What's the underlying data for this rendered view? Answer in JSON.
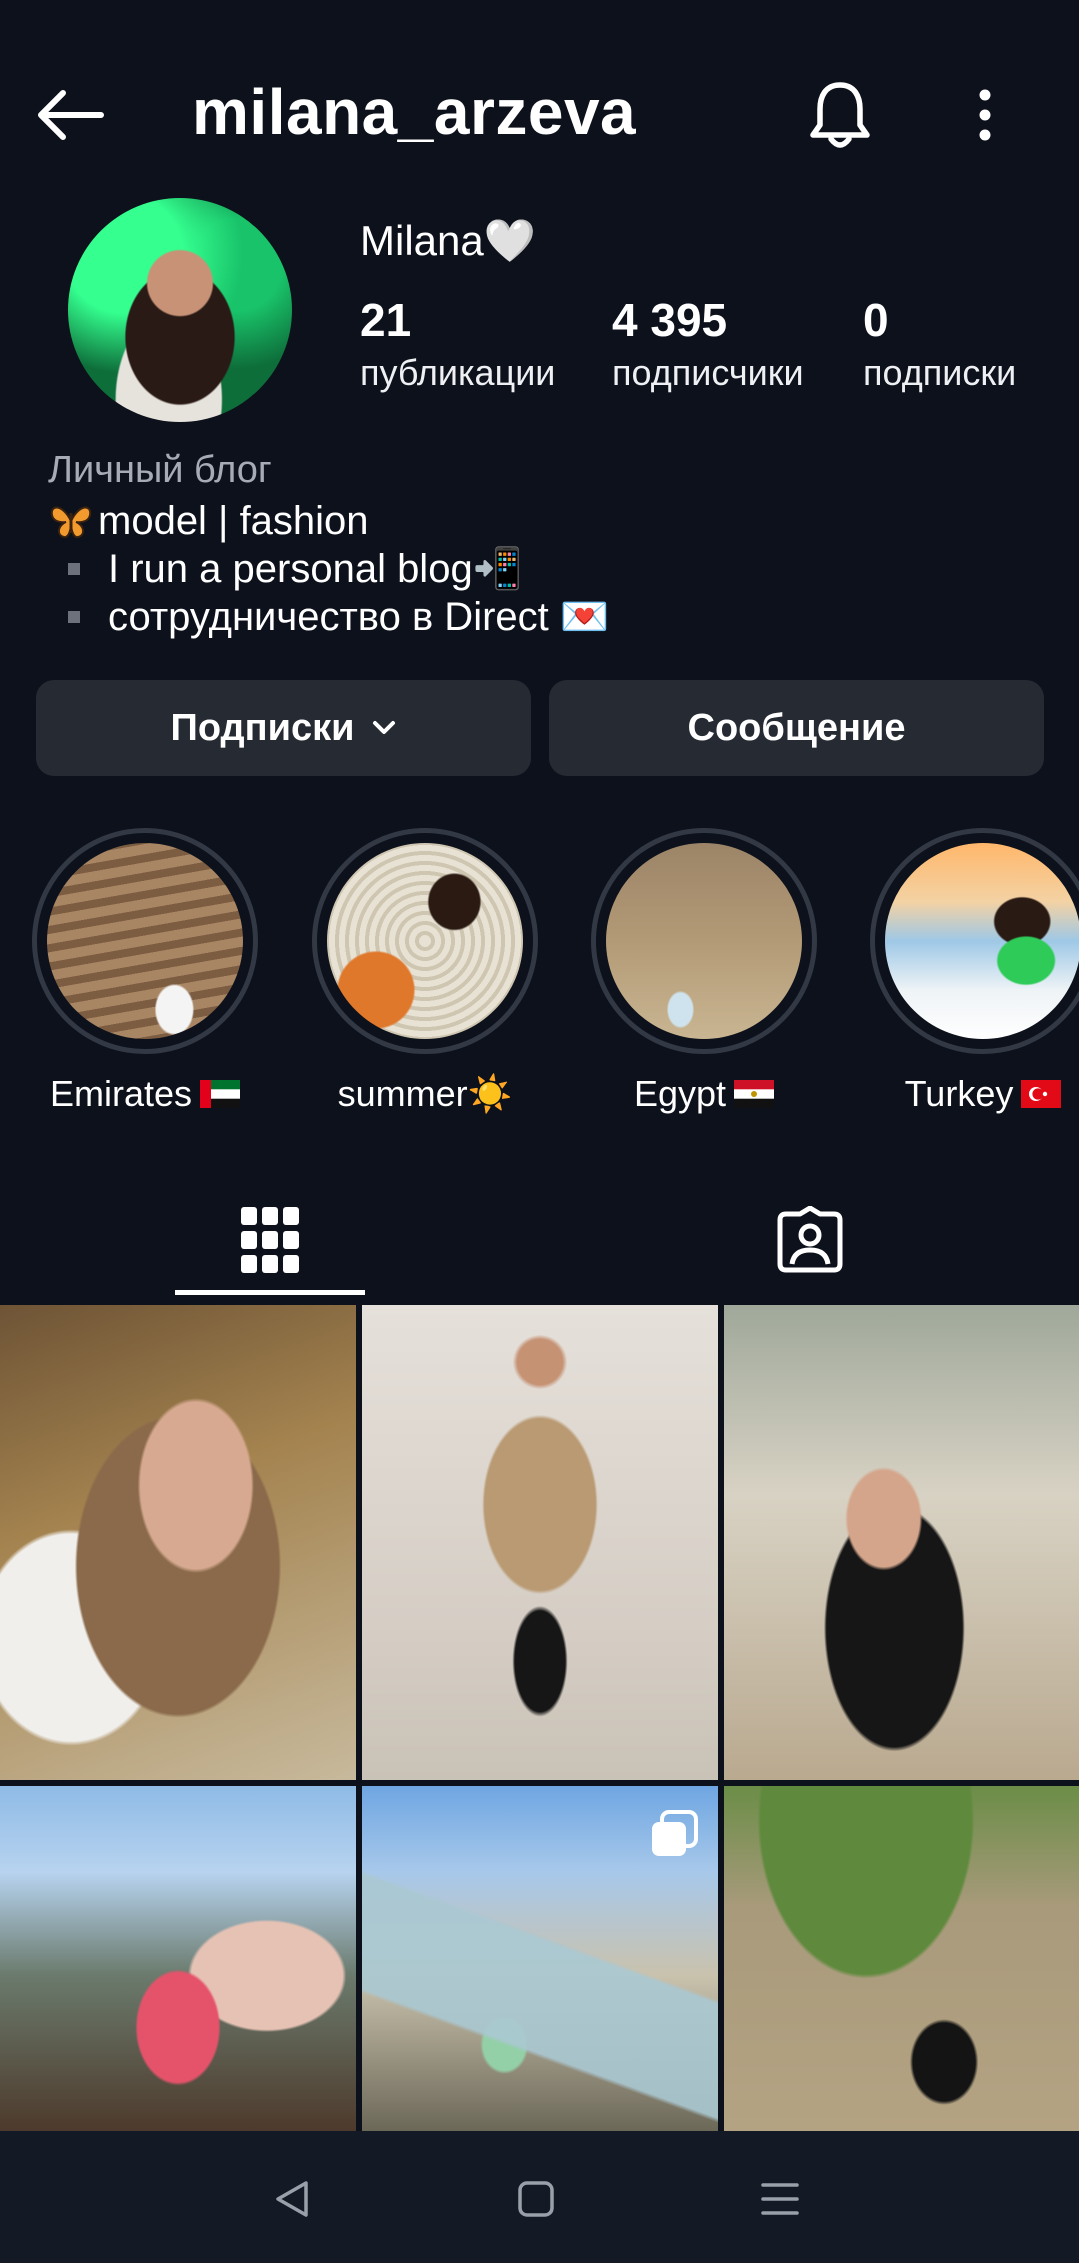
{
  "header": {
    "username": "milana_arzeva",
    "back_icon": "arrow-left-icon",
    "bell_icon": "bell-icon",
    "more_icon": "more-vertical-icon"
  },
  "profile": {
    "display_name": "Milana🤍",
    "stats": [
      {
        "value": "21",
        "label": "публикации"
      },
      {
        "value": "4 395",
        "label": "подписчики"
      },
      {
        "value": "0",
        "label": "подписки"
      }
    ],
    "category": "Личный блог",
    "bio": {
      "line1": "model | fashion",
      "line2": "I run a personal blog📲",
      "line3": "сотрудничество в Direct 💌"
    }
  },
  "buttons": {
    "follow_label": "Подписки",
    "message_label": "Сообщение"
  },
  "highlights": [
    {
      "label": "Emirates",
      "flag": "ae"
    },
    {
      "label": "summer☀️",
      "flag": ""
    },
    {
      "label": "Egypt",
      "flag": "eg"
    },
    {
      "label": "Turkey",
      "flag": "tr"
    }
  ],
  "tabs": {
    "grid_icon": "grid-icon",
    "tagged_icon": "tagged-person-icon",
    "active": "grid"
  },
  "colors": {
    "background": "#0c111b",
    "button_bg": "#262b33",
    "muted_text": "#a6abb5",
    "navbar_bg": "#141a25"
  }
}
